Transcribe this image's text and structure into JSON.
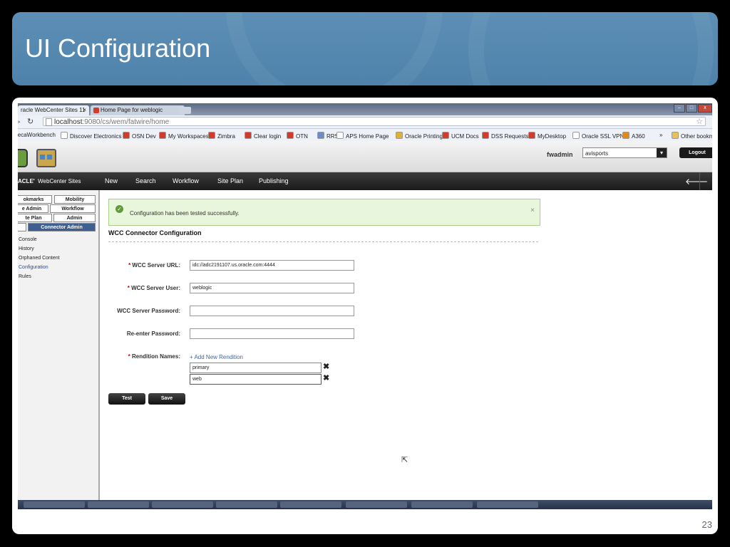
{
  "slide": {
    "title": "UI Configuration",
    "page_number": "23"
  },
  "browser": {
    "tabs": [
      {
        "label": "racle WebCenter Sites 11",
        "close": "×"
      },
      {
        "label": "Home Page for weblogic",
        "close": "×"
      }
    ],
    "url_host": "localhost",
    "url_rest": ":9080/cs/wem/fatwire/home",
    "bookmarks": [
      {
        "label": "lecaWorkbench",
        "icon": "none",
        "color": ""
      },
      {
        "label": "Discover Electronics",
        "icon": "page-icon",
        "color": "#ffffff"
      },
      {
        "label": "OSN Dev",
        "icon": "globe-icon",
        "color": "#d23a2a"
      },
      {
        "label": "My Workspaces",
        "icon": "workspace-icon",
        "color": "#d23a2a"
      },
      {
        "label": "Zimbra",
        "icon": "mail-icon",
        "color": "#d23a2a"
      },
      {
        "label": "Clear login",
        "icon": "login-icon",
        "color": "#d23a2a"
      },
      {
        "label": "OTN",
        "icon": "oracle-icon",
        "color": "#d23a2a"
      },
      {
        "label": "RRS",
        "icon": "table-icon",
        "color": "#6b8cc4"
      },
      {
        "label": "APS Home Page",
        "icon": "page-icon",
        "color": "#ffffff"
      },
      {
        "label": "Oracle Printing",
        "icon": "print-icon",
        "color": "#e0b030"
      },
      {
        "label": "UCM Docs",
        "icon": "oracle-icon",
        "color": "#d23a2a"
      },
      {
        "label": "DSS Requests",
        "icon": "oracle-icon",
        "color": "#d23a2a"
      },
      {
        "label": "MyDesktop",
        "icon": "oracle-icon",
        "color": "#d23a2a"
      },
      {
        "label": "Oracle SSL VPN",
        "icon": "page-icon",
        "color": "#ffffff"
      },
      {
        "label": "A360",
        "icon": "a360-icon",
        "color": "#e08a1a"
      },
      {
        "label": "»",
        "icon": "none",
        "color": ""
      },
      {
        "label": "Other bookm",
        "icon": "folder-icon",
        "color": "#e8c15a"
      }
    ]
  },
  "app": {
    "username": "fwadmin",
    "site_selected": "avisports",
    "logout_label": "Logout",
    "brand_prefix": "ACLE'",
    "brand_name": "WebCenter Sites",
    "menu": [
      "New",
      "Search",
      "Workflow",
      "Site Plan",
      "Publishing"
    ]
  },
  "sidebar": {
    "tabs_row1": [
      "okmarks",
      "Mobility"
    ],
    "tabs_row2": [
      "e Admin",
      "Workflow"
    ],
    "tabs_row3": [
      "te Plan",
      "Admin"
    ],
    "active_tab": "Connector Admin",
    "links": [
      "Console",
      "History",
      "Orphaned Content",
      "Configuration",
      "Rules"
    ],
    "selected_link": "Configuration"
  },
  "main": {
    "notice": "Configuration has been tested successfully.",
    "section_title": "WCC Connector Configuration",
    "fields": [
      {
        "label": "WCC Server URL:",
        "required": true,
        "value": "idc://adc2191107.us.oracle.com:4444"
      },
      {
        "label": "WCC Server User:",
        "required": true,
        "value": "weblogic"
      },
      {
        "label": "WCC Server Password:",
        "required": false,
        "value": ""
      },
      {
        "label": "Re-enter Password:",
        "required": false,
        "value": ""
      }
    ],
    "renditions_label": "Rendition Names:",
    "add_rendition": "+ Add New Rendition",
    "renditions": [
      "primary",
      "web"
    ],
    "test_button": "Test",
    "save_button": "Save"
  },
  "colors": {
    "accent": "#4f82aa",
    "active_tab": "#3e5f8f",
    "success_bg": "#e8f6dc",
    "required": "#cc0000"
  }
}
